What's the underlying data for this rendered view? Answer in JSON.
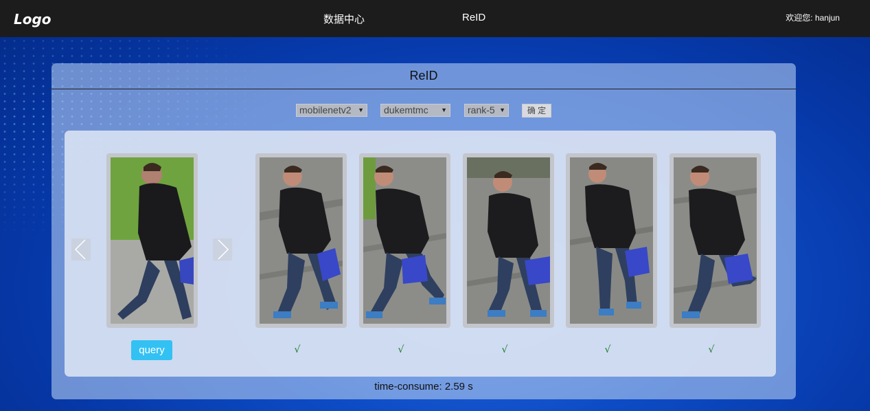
{
  "header": {
    "logo": "Logo",
    "nav": [
      "数据中心",
      "ReID"
    ],
    "welcome": "欢迎您: hanjun"
  },
  "panel": {
    "title": "ReID",
    "controls": {
      "model": "mobilenetv2",
      "dataset": "dukemtmc",
      "rank": "rank-5",
      "confirm_label": "确 定"
    },
    "query_label": "query",
    "results": [
      {
        "mark": "√"
      },
      {
        "mark": "√"
      },
      {
        "mark": "√"
      },
      {
        "mark": "√"
      },
      {
        "mark": "√"
      }
    ],
    "time_consume": "time-consume: 2.59 s"
  },
  "icons": {
    "prev": "chevron-left-icon",
    "next": "chevron-right-icon"
  },
  "colors": {
    "topbar": "#1c1c1c",
    "query_button": "#33c1f3",
    "check": "#1a7a2a"
  }
}
